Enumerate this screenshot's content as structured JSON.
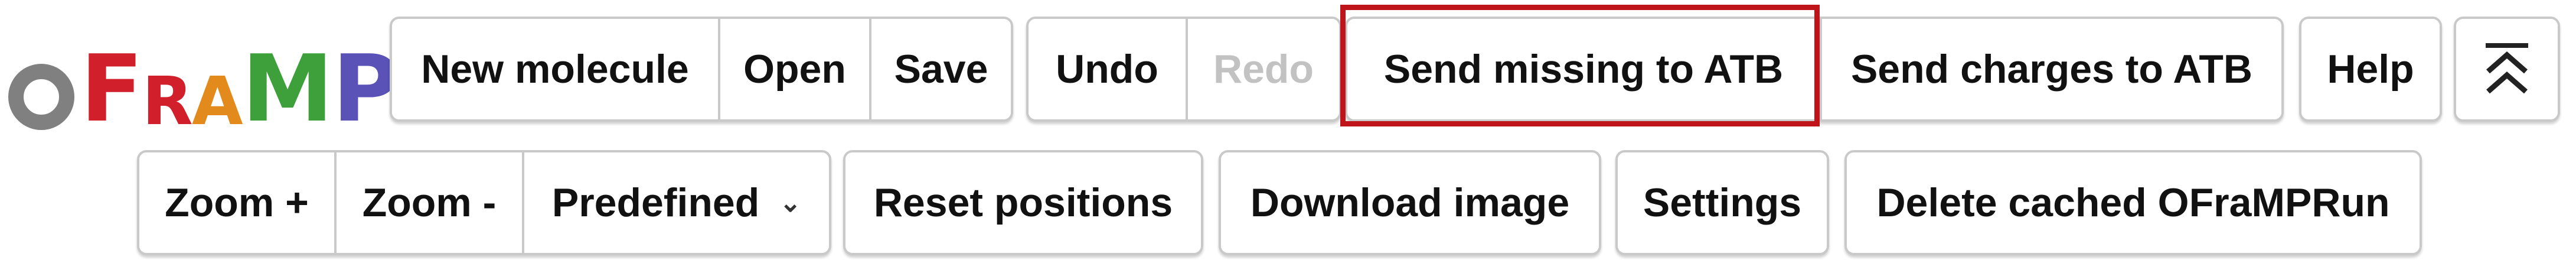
{
  "logo": {
    "letters": [
      "F",
      "R",
      "A",
      "M",
      "P"
    ],
    "colors": {
      "ring": "#808080",
      "F": "#d11f2b",
      "R": "#d11f2b",
      "A": "#e28a1b",
      "M": "#3ea03a",
      "P": "#5a52b7"
    }
  },
  "toolbar_top": {
    "new_molecule": "New molecule",
    "open": "Open",
    "save": "Save",
    "undo": "Undo",
    "redo": "Redo",
    "send_missing": "Send missing to ATB",
    "send_charges": "Send charges to ATB",
    "help": "Help",
    "collapse_icon": "double-chevron-up-icon"
  },
  "toolbar_bottom": {
    "zoom_in": "Zoom +",
    "zoom_out": "Zoom -",
    "predefined": "Predefined",
    "reset_positions": "Reset positions",
    "download_image": "Download image",
    "settings": "Settings",
    "delete_cached": "Delete cached OFraMPRun"
  },
  "highlight_color": "#c0141b"
}
